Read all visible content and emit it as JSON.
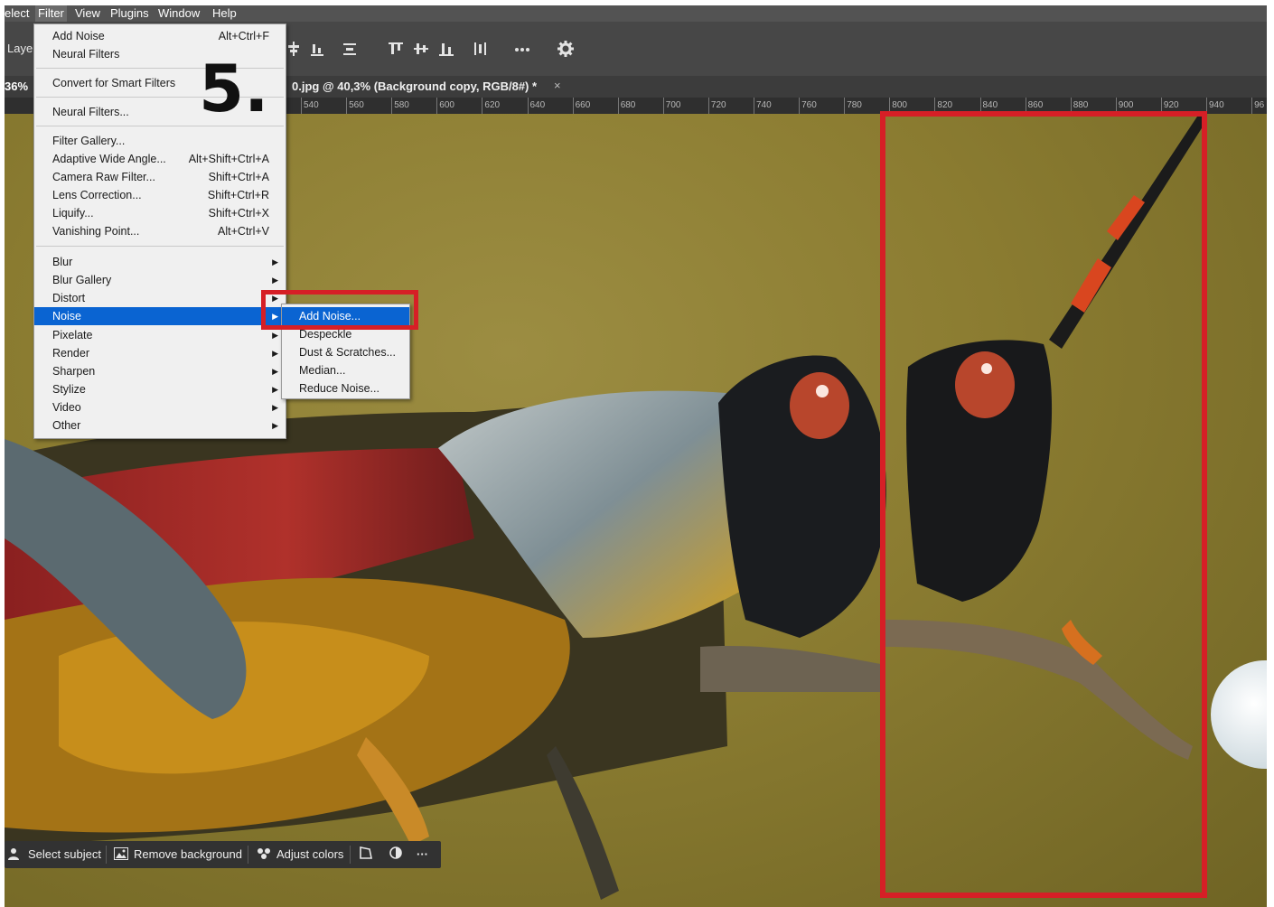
{
  "menubar": {
    "items": [
      {
        "label": "elect"
      },
      {
        "label": "Filter"
      },
      {
        "label": "View"
      },
      {
        "label": "Plugins"
      },
      {
        "label": "Window"
      },
      {
        "label": "Help"
      }
    ]
  },
  "options_bar": {
    "layer_label": "Laye"
  },
  "document_tab": {
    "zoom": "36%",
    "title": "0.jpg @ 40,3% (Background copy, RGB/8#) *",
    "close": "×"
  },
  "ruler": {
    "ticks": [
      "540",
      "560",
      "580",
      "600",
      "620",
      "640",
      "660",
      "680",
      "700",
      "720",
      "740",
      "760",
      "780",
      "800",
      "820",
      "840",
      "860",
      "880",
      "900",
      "920",
      "940",
      "96"
    ]
  },
  "filter_menu": {
    "items": [
      {
        "label": "Add Noise",
        "shortcut": "Alt+Ctrl+F"
      },
      {
        "label": "Neural Filters",
        "shortcut": ""
      },
      {
        "label": "Convert for Smart Filters",
        "shortcut": ""
      },
      {
        "label": "Neural Filters...",
        "shortcut": ""
      },
      {
        "label": "Filter Gallery...",
        "shortcut": ""
      },
      {
        "label": "Adaptive Wide Angle...",
        "shortcut": "Alt+Shift+Ctrl+A"
      },
      {
        "label": "Camera Raw Filter...",
        "shortcut": "Shift+Ctrl+A"
      },
      {
        "label": "Lens Correction...",
        "shortcut": "Shift+Ctrl+R"
      },
      {
        "label": "Liquify...",
        "shortcut": "Shift+Ctrl+X"
      },
      {
        "label": "Vanishing Point...",
        "shortcut": "Alt+Ctrl+V"
      },
      {
        "label": "Blur"
      },
      {
        "label": "Blur Gallery"
      },
      {
        "label": "Distort"
      },
      {
        "label": "Noise"
      },
      {
        "label": "Pixelate"
      },
      {
        "label": "Render"
      },
      {
        "label": "Sharpen"
      },
      {
        "label": "Stylize"
      },
      {
        "label": "Video"
      },
      {
        "label": "Other"
      }
    ]
  },
  "noise_submenu": {
    "items": [
      {
        "label": "Add Noise..."
      },
      {
        "label": "Despeckle"
      },
      {
        "label": "Dust & Scratches..."
      },
      {
        "label": "Median..."
      },
      {
        "label": "Reduce Noise..."
      }
    ]
  },
  "step_label": "5.",
  "contextual_bar": {
    "select_subject": "Select subject",
    "remove_background": "Remove background",
    "adjust_colors": "Adjust colors",
    "more": "···"
  },
  "colors": {
    "highlight": "#d61f26",
    "menu_selection": "#0a64d2"
  }
}
